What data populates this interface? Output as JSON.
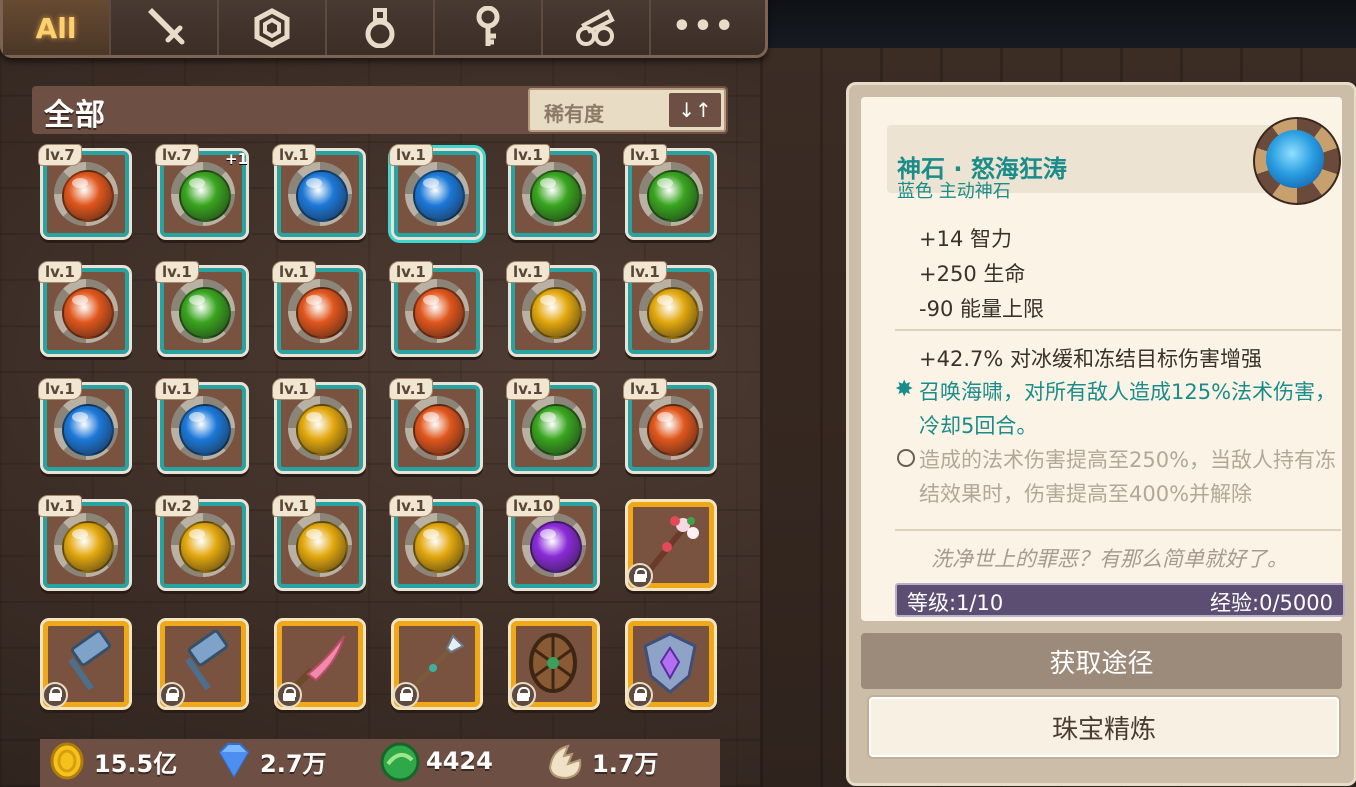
{
  "tabs": [
    {
      "label": "All",
      "icon": "all"
    },
    {
      "label": "",
      "icon": "sword-icon"
    },
    {
      "label": "",
      "icon": "hexagon-icon"
    },
    {
      "label": "",
      "icon": "potion-icon"
    },
    {
      "label": "",
      "icon": "key-icon"
    },
    {
      "label": "",
      "icon": "scrolls-icon"
    },
    {
      "label": "•••",
      "icon": "more-icon"
    }
  ],
  "inventory": {
    "title": "全部",
    "sort_label": "稀有度",
    "sort_icon": "sort-icon",
    "items": [
      {
        "level": "lv.7",
        "type": "gem",
        "color": "#e0561c",
        "plus": ""
      },
      {
        "level": "lv.7",
        "type": "gem",
        "color": "#39a51f",
        "plus": "+1"
      },
      {
        "level": "lv.1",
        "type": "gem",
        "color": "#1c78d8",
        "plus": ""
      },
      {
        "level": "lv.1",
        "type": "gem",
        "color": "#1c78d8",
        "plus": "",
        "selected": true
      },
      {
        "level": "lv.1",
        "type": "gem",
        "color": "#39a51f",
        "plus": ""
      },
      {
        "level": "lv.1",
        "type": "gem",
        "color": "#39a51f",
        "plus": ""
      },
      {
        "level": "lv.1",
        "type": "gem",
        "color": "#e0561c",
        "plus": ""
      },
      {
        "level": "lv.1",
        "type": "gem",
        "color": "#39a51f",
        "plus": ""
      },
      {
        "level": "lv.1",
        "type": "gem",
        "color": "#e0561c",
        "plus": ""
      },
      {
        "level": "lv.1",
        "type": "gem",
        "color": "#e0561c",
        "plus": ""
      },
      {
        "level": "lv.1",
        "type": "gem",
        "color": "#e3a80e",
        "plus": ""
      },
      {
        "level": "lv.1",
        "type": "gem",
        "color": "#e3a80e",
        "plus": ""
      },
      {
        "level": "lv.1",
        "type": "gem",
        "color": "#1c78d8",
        "plus": ""
      },
      {
        "level": "lv.1",
        "type": "gem",
        "color": "#1c78d8",
        "plus": ""
      },
      {
        "level": "lv.1",
        "type": "gem",
        "color": "#e3a80e",
        "plus": ""
      },
      {
        "level": "lv.1",
        "type": "gem",
        "color": "#e0561c",
        "plus": ""
      },
      {
        "level": "lv.1",
        "type": "gem",
        "color": "#39a51f",
        "plus": ""
      },
      {
        "level": "lv.1",
        "type": "gem",
        "color": "#e0561c",
        "plus": ""
      },
      {
        "level": "lv.1",
        "type": "gem",
        "color": "#e3a80e",
        "plus": ""
      },
      {
        "level": "lv.2",
        "type": "gem",
        "color": "#e3a80e",
        "plus": ""
      },
      {
        "level": "lv.1",
        "type": "gem",
        "color": "#e3a80e",
        "plus": ""
      },
      {
        "level": "lv.1",
        "type": "gem",
        "color": "#e3a80e",
        "plus": ""
      },
      {
        "level": "lv.10",
        "type": "gem",
        "color": "#8a2bd8",
        "plus": ""
      },
      {
        "level": "",
        "type": "flower-staff",
        "locked": true
      },
      {
        "level": "",
        "type": "hammer",
        "locked": true
      },
      {
        "level": "",
        "type": "hammer",
        "locked": true
      },
      {
        "level": "",
        "type": "pink-blade",
        "locked": true
      },
      {
        "level": "",
        "type": "spear",
        "locked": true
      },
      {
        "level": "",
        "type": "wooden-shield",
        "locked": true
      },
      {
        "level": "",
        "type": "crystal-shield",
        "locked": true
      }
    ]
  },
  "resources": [
    {
      "icon": "gold-coin-icon",
      "value": "15.5亿"
    },
    {
      "icon": "diamond-icon",
      "value": "2.7万"
    },
    {
      "icon": "green-orb-icon",
      "value": "4424"
    },
    {
      "icon": "eggshell-icon",
      "value": "1.7万"
    }
  ],
  "detail": {
    "name": "神石 · 怒海狂涛",
    "type": "蓝色 主动神石",
    "stats": [
      "+14 智力",
      "+250 生命",
      "-90 能量上限"
    ],
    "bonus": "+42.7% 对冰缓和冻结目标伤害增强",
    "skill": "召唤海啸，对所有敌人造成125%法术伤害，冷却5回合。",
    "locked_skill": "造成的法术伤害提高至250%，当敌人持有冻结效果时，伤害提高至400%并解除",
    "flavor": "洗净世上的罪恶？有那么简单就好了。",
    "level_text": "等级:1/10",
    "exp_text": "经验:0/5000",
    "source_button": "获取途径",
    "refine_button": "珠宝精炼"
  }
}
